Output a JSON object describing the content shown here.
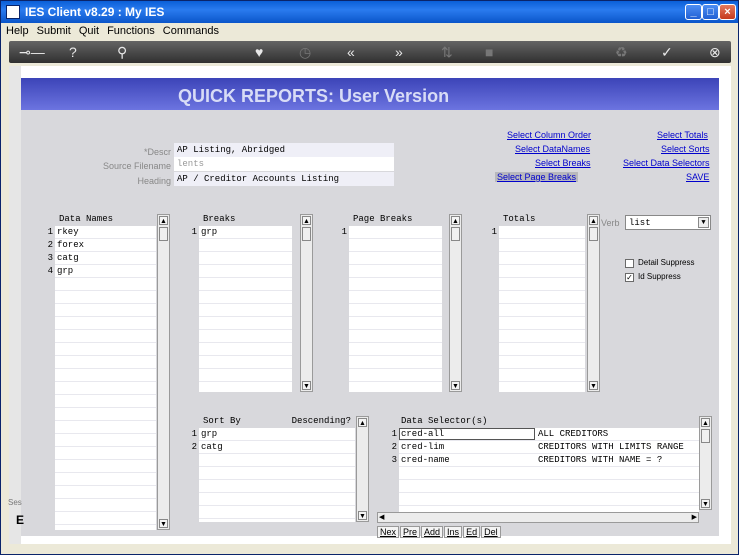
{
  "window": {
    "title": "IES Client v8.29 : My IES"
  },
  "menu": [
    "Help",
    "Submit",
    "Quit",
    "Functions",
    "Commands"
  ],
  "toolbar_icons": [
    "key-icon",
    "help-icon",
    "search-icon",
    "heart-icon",
    "clock-icon",
    "rewind-icon",
    "forward-icon",
    "info-icon",
    "stop-icon",
    "recycle-icon",
    "check-icon",
    "close-icon"
  ],
  "page": {
    "title": "QUICK REPORTS: User Version"
  },
  "form": {
    "descr_label": "*Descr",
    "descr_value": "AP Listing, Abridged",
    "source_label": "Source Filename",
    "source_value": "lents",
    "heading_label": "Heading",
    "heading_value": "AP / Creditor Accounts Listing"
  },
  "links": {
    "select_column_order": "Select Column Order",
    "select_datanames": "Select DataNames",
    "select_breaks": "Select Breaks",
    "select_page_breaks": "Select Page Breaks",
    "select_totals": "Select Totals",
    "select_sorts": "Select Sorts",
    "select_data_selectors": "Select Data Selectors",
    "save": "SAVE"
  },
  "data_names": {
    "header": "Data Names",
    "rows": [
      {
        "n": "1",
        "v": "rkey"
      },
      {
        "n": "2",
        "v": "forex"
      },
      {
        "n": "3",
        "v": "catg"
      },
      {
        "n": "4",
        "v": "grp"
      }
    ]
  },
  "breaks": {
    "header": "Breaks",
    "rows": [
      {
        "n": "1",
        "v": "grp"
      }
    ]
  },
  "page_breaks": {
    "header": "Page Breaks",
    "rows": [
      {
        "n": "1",
        "v": ""
      }
    ]
  },
  "totals": {
    "header": "Totals",
    "rows": [
      {
        "n": "1",
        "v": ""
      }
    ]
  },
  "verb": {
    "label": "Verb",
    "value": "list"
  },
  "options": {
    "detail_suppress": "Detail Suppress",
    "detail_checked": false,
    "id_suppress": "Id Suppress",
    "id_checked": true
  },
  "sort_by": {
    "header": "Sort By",
    "desc_header": "Descending?",
    "rows": [
      {
        "n": "1",
        "v": "grp"
      },
      {
        "n": "2",
        "v": "catg"
      }
    ]
  },
  "data_selectors": {
    "header": "Data Selector(s)",
    "rows": [
      {
        "n": "1",
        "v": "cred-all",
        "d": "ALL CREDITORS"
      },
      {
        "n": "2",
        "v": "cred-lim",
        "d": "CREDITORS WITH LIMITS RANGE"
      },
      {
        "n": "3",
        "v": "cred-name",
        "d": "CREDITORS WITH NAME = ?"
      }
    ]
  },
  "row_buttons": [
    "Nex",
    "Pre",
    "Add",
    "Ins",
    "Ed",
    "Del"
  ],
  "status": {
    "left": "Ses",
    "letter": "E"
  }
}
